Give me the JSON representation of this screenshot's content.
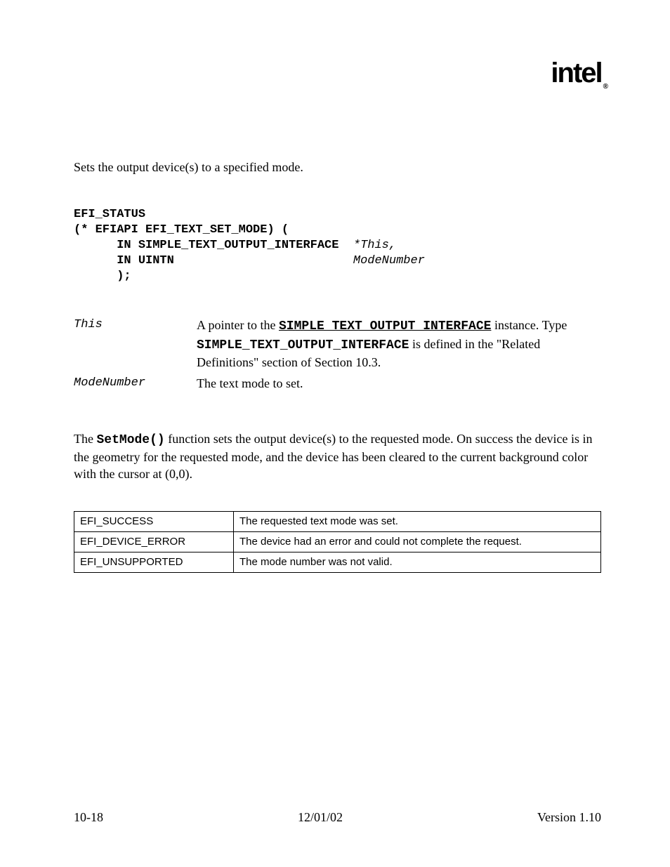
{
  "logo": "intel",
  "logo_reg": "®",
  "summary": "Sets the output device(s) to a specified mode.",
  "proto": {
    "l1": "EFI_STATUS",
    "l2": "(* EFIAPI EFI_TEXT_SET_MODE) (",
    "l3_kw": "      IN SIMPLE_TEXT_OUTPUT_INTERFACE  ",
    "l3_it": "*This,",
    "l4_kw": "      IN UINTN                         ",
    "l4_it": "ModeNumber",
    "l5": "      );"
  },
  "params": {
    "this_name": "This",
    "this_desc_pre": "A pointer to the ",
    "this_desc_code1": "SIMPLE_TEXT_OUTPUT_INTERFACE",
    "this_desc_mid1": " instance. Type ",
    "this_desc_code2": "SIMPLE_TEXT_OUTPUT_INTERFACE",
    "this_desc_post": " is defined in the \"Related Definitions\" section of Section 10.3.",
    "mode_name": "ModeNumber",
    "mode_desc": "The text mode to set."
  },
  "description": {
    "pre": "The ",
    "code": "SetMode()",
    "post": " function sets the output device(s) to the requested mode.  On success the device is in the geometry for the requested mode, and the device has been cleared to the current background color with the cursor at (0,0)."
  },
  "status_rows": [
    {
      "code": "EFI_SUCCESS",
      "desc": "The requested text mode was set."
    },
    {
      "code": "EFI_DEVICE_ERROR",
      "desc": "The device had an error and could not complete the request."
    },
    {
      "code": "EFI_UNSUPPORTED",
      "desc": "The mode number was not valid."
    }
  ],
  "footer": {
    "left": "10-18",
    "center": "12/01/02",
    "right": "Version 1.10"
  }
}
